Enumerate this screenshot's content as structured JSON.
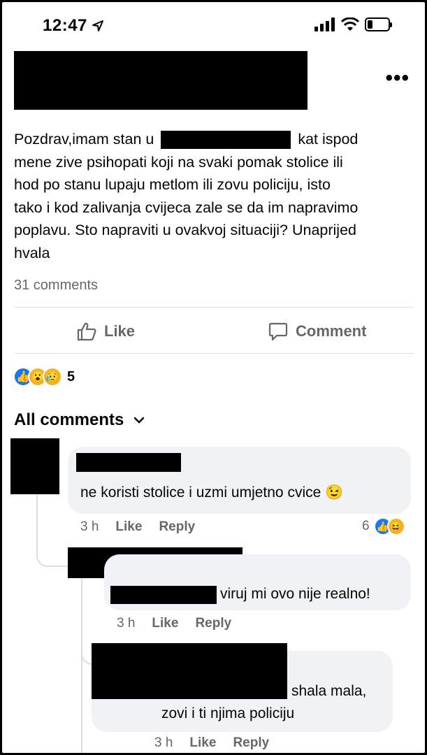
{
  "status_bar": {
    "time": "12:47"
  },
  "post": {
    "line1_start": "Pozdrav,imam stan u",
    "line1_end": "kat ispod",
    "line2": "mene zive psihopati koji na svaki pomak stolice ili",
    "line3": "hod po stanu lupaju metlom ili zovu policiju, isto",
    "line4": "tako i kod zalivanja cvijeca zale se da im napravimo",
    "line5": "poplavu. Sto napraviti u ovakvoj situaciji? Unaprijed",
    "line6": "hvala",
    "comments_count": "31 comments",
    "like_label": "Like",
    "comment_label": "Comment",
    "reactions_count": "5",
    "reaction_icons": [
      "like-icon",
      "wow-emoji-icon",
      "sad-emoji-icon"
    ]
  },
  "comments_section": {
    "title": "All comments"
  },
  "comments": [
    {
      "text": "ne koristi stolice i uzmi umjetno cvice 😉",
      "time": "3 h",
      "like": "Like",
      "reply": "Reply",
      "reactions_count": "6",
      "reaction_icons": [
        "like-icon",
        "haha-emoji-icon"
      ]
    },
    {
      "text": "viruj mi ovo nije realno!",
      "time": "3 h",
      "like": "Like",
      "reply": "Reply"
    },
    {
      "text_line1": "shala mala,",
      "text_line2": "zovi i ti njima policiju",
      "time": "3 h",
      "like": "Like",
      "reply": "Reply"
    }
  ],
  "colors": {
    "accent": "#1877f2",
    "muted_text": "#65676b",
    "bubble": "#f0f2f5"
  }
}
